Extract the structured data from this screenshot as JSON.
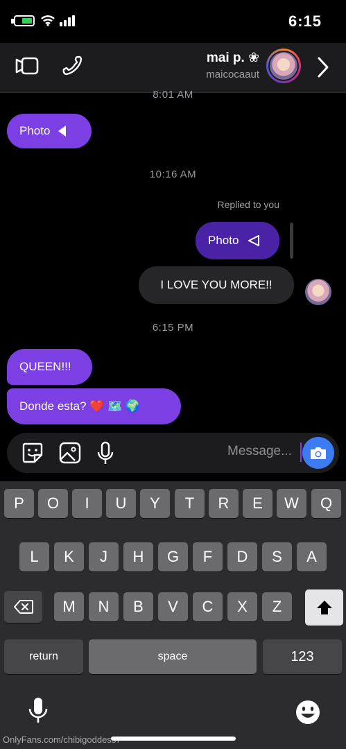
{
  "status": {
    "time": "6:15"
  },
  "header": {
    "name": "mai p. ❀",
    "username": "maicocaaut"
  },
  "chat": {
    "timestamps": [
      "8:01 AM",
      "10:16 AM",
      "6:15 PM"
    ],
    "photo_label": "Photo",
    "reply_label": "Replied to you",
    "reply_photo_label": "Photo",
    "message_love": "I LOVE YOU MORE!!",
    "message_queen": "QUEEN!!!",
    "message_donde": "Donde esta? ❤️ 🗺️ 🌍"
  },
  "composer": {
    "placeholder": "Message..."
  },
  "keyboard": {
    "row1": [
      "Q",
      "W",
      "E",
      "R",
      "T",
      "Y",
      "U",
      "I",
      "O",
      "P"
    ],
    "row2": [
      "A",
      "S",
      "D",
      "F",
      "G",
      "H",
      "J",
      "K",
      "L"
    ],
    "row3": [
      "Z",
      "X",
      "C",
      "V",
      "B",
      "N",
      "M"
    ],
    "numbers": "123",
    "space": "space",
    "return": "return"
  },
  "watermark": "OnlyFans.com/chibigoddess7",
  "colors": {
    "accent": "#7b3fe4",
    "deep_accent": "#4a22a6",
    "camera": "#3d7bf5"
  }
}
